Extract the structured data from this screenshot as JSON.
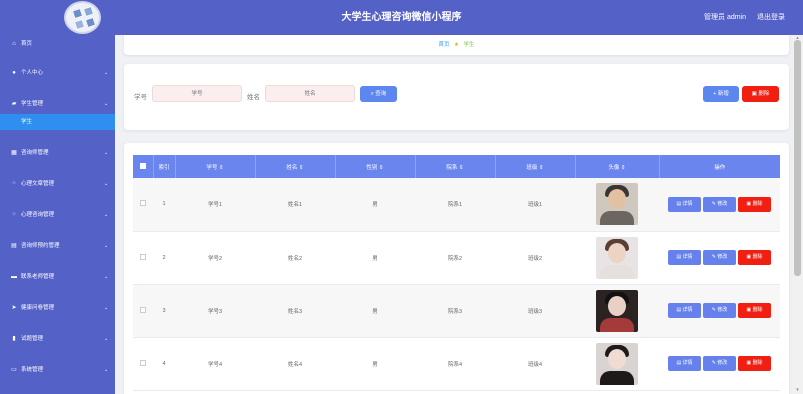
{
  "header": {
    "title": "大学生心理咨询微信小程序",
    "admin_label": "管理员 admin",
    "logout_label": "退出登录"
  },
  "sidebar": {
    "items": [
      {
        "label": "首页",
        "icon": "home-icon",
        "glyph": "⌂",
        "chevron": ""
      },
      {
        "label": "个人中心",
        "icon": "user-icon",
        "glyph": "●",
        "chevron": "⌄"
      },
      {
        "label": "学生管理",
        "icon": "folder-icon",
        "glyph": "▰",
        "chevron": "⌄"
      },
      {
        "label": "咨询师管理",
        "icon": "grid-icon",
        "glyph": "▦",
        "chevron": "⌄"
      },
      {
        "label": "心理文章管理",
        "icon": "apps-icon",
        "glyph": "⁘",
        "chevron": "⌄"
      },
      {
        "label": "心理咨询管理",
        "icon": "apps-icon",
        "glyph": "⁘",
        "chevron": "⌄"
      },
      {
        "label": "咨询师预约管理",
        "icon": "document-icon",
        "glyph": "▤",
        "chevron": "⌄"
      },
      {
        "label": "联系老师管理",
        "icon": "chat-icon",
        "glyph": "▬",
        "chevron": "⌄"
      },
      {
        "label": "健康问卷管理",
        "icon": "send-icon",
        "glyph": "➤",
        "chevron": "⌄"
      },
      {
        "label": "试题管理",
        "icon": "chart-icon",
        "glyph": "▮",
        "chevron": "⌄"
      },
      {
        "label": "系统管理",
        "icon": "computer-icon",
        "glyph": "▭",
        "chevron": "⌄"
      }
    ],
    "sub_active": "学生"
  },
  "breadcrumb": {
    "home": "首页",
    "current": "学生"
  },
  "search": {
    "field1_label": "学号",
    "field1_placeholder": "学号",
    "field2_label": "姓名",
    "field2_placeholder": "姓名",
    "query_button": "查询",
    "add_button": "新增",
    "delete_button": "删除"
  },
  "table": {
    "columns": [
      "",
      "索引",
      "学号 ⇕",
      "姓名 ⇕",
      "性别 ⇕",
      "院系 ⇕",
      "班级 ⇕",
      "头像 ⇕",
      "操作"
    ],
    "rows": [
      {
        "index": "1",
        "student_id": "学号1",
        "name": "姓名1",
        "gender": "男",
        "department": "院系1",
        "class": "班级1"
      },
      {
        "index": "2",
        "student_id": "学号2",
        "name": "姓名2",
        "gender": "男",
        "department": "院系2",
        "class": "班级2"
      },
      {
        "index": "3",
        "student_id": "学号3",
        "name": "姓名3",
        "gender": "男",
        "department": "院系3",
        "class": "班级3"
      },
      {
        "index": "4",
        "student_id": "学号4",
        "name": "姓名4",
        "gender": "男",
        "department": "院系4",
        "class": "班级4"
      }
    ],
    "actions": {
      "detail": "详情",
      "edit": "修改",
      "delete": "删除"
    }
  },
  "colors": {
    "primary": "#5461c7",
    "accent_blue": "#5d86ee",
    "danger": "#f01f12",
    "active_item": "#2e8ff0"
  }
}
